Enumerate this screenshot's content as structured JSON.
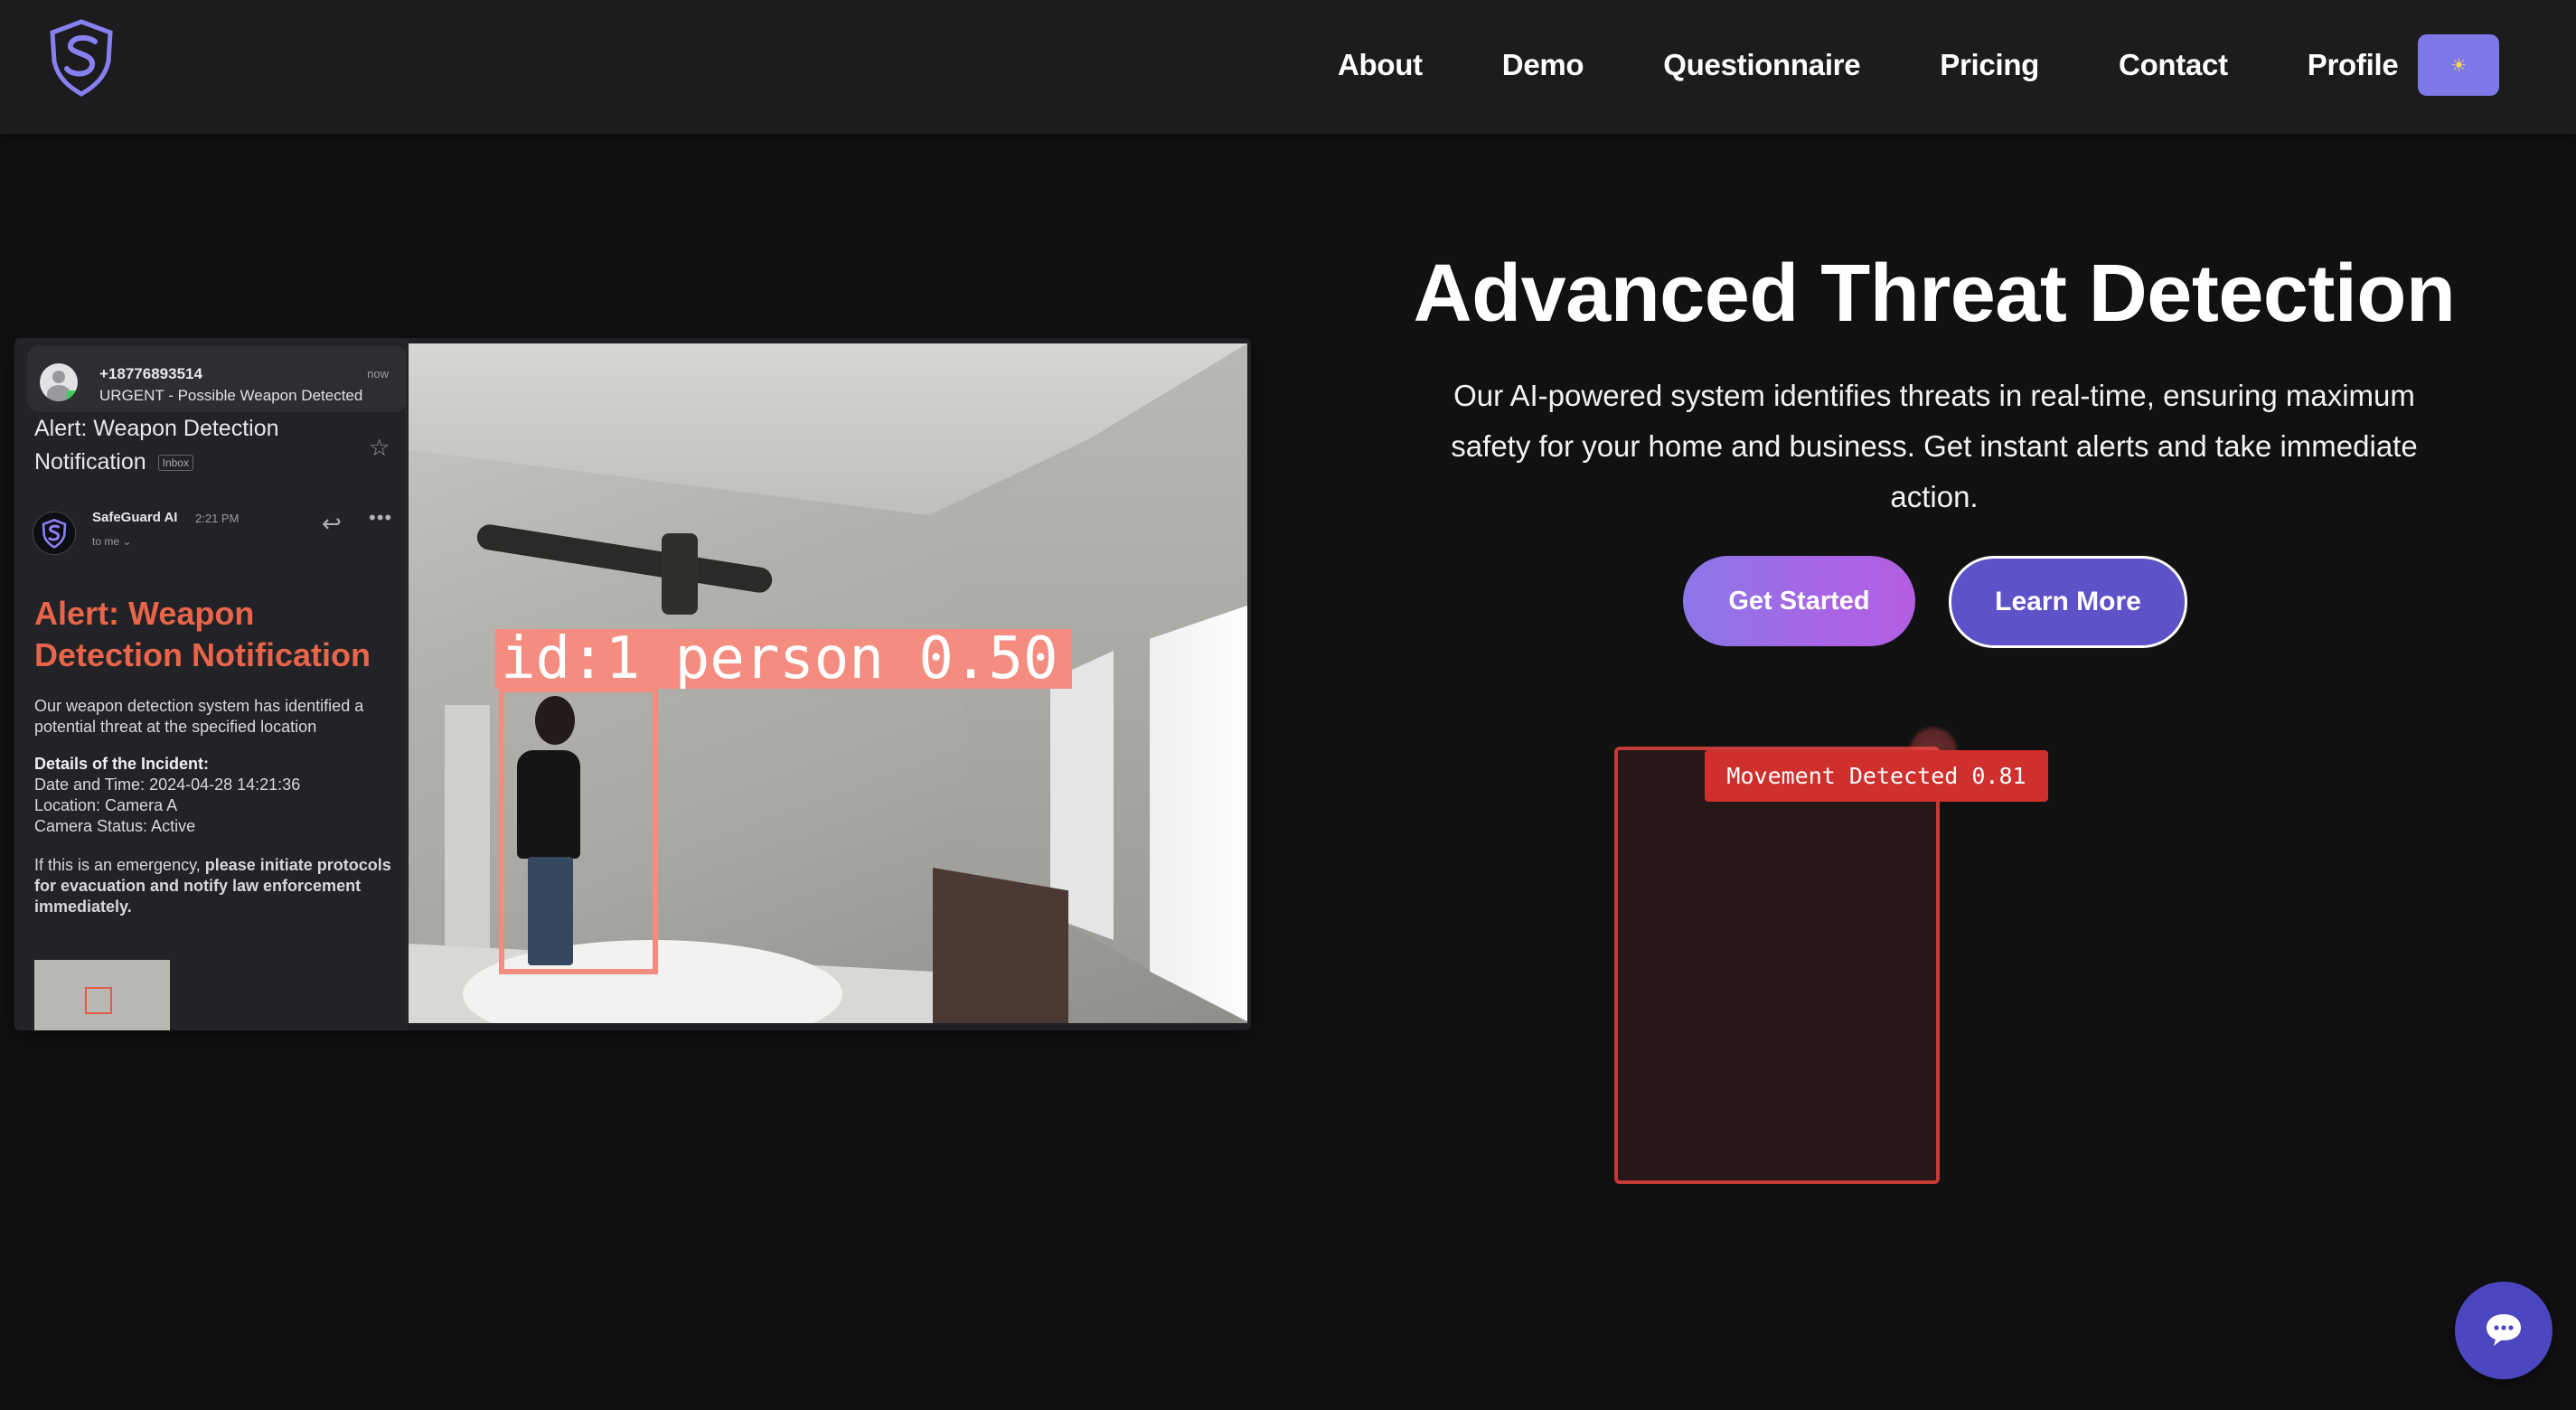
{
  "nav": {
    "logo_icon": "shield-s-icon",
    "links": [
      "About",
      "Demo",
      "Questionnaire",
      "Pricing",
      "Contact",
      "Profile"
    ],
    "theme_toggle_icon": "sun-icon",
    "theme_toggle_glyph": "☀"
  },
  "hero": {
    "title": "Advanced Threat Detection",
    "description": "Our AI-powered system identifies threats in real-time, ensuring maximum safety for your home and business. Get instant alerts and take immediate action.",
    "primary_button": "Get Started",
    "secondary_button": "Learn More"
  },
  "notification": {
    "sender_number": "+18776893514",
    "time": "now",
    "message": "URGENT - Possible Weapon Detected"
  },
  "email": {
    "subject": "Alert: Weapon Detection Notification",
    "inbox_tag": "Inbox",
    "sender_name": "SafeGuard AI",
    "sender_time": "2:21 PM",
    "to": "to me ⌄",
    "heading": "Alert: Weapon Detection Notification",
    "intro": "Our weapon detection system has identified a potential threat at the specified location",
    "details_title": "Details of the Incident:",
    "details": [
      "Date and Time: 2024-04-28 14:21:36",
      "Location: Camera A",
      "Camera Status: Active"
    ],
    "emergency_prefix": "If this is an emergency, ",
    "emergency_bold": "please initiate protocols for evacuation and notify law enforcement immediately."
  },
  "camera": {
    "detection_label": "id:1 person 0.50"
  },
  "motion": {
    "label": "Movement Detected 0.81"
  },
  "chat": {
    "icon": "chat-bubble-icon"
  },
  "colors": {
    "accent": "#7d78e8",
    "alert_red": "#d0302d",
    "email_heading": "#e8644a",
    "detection_box": "#f48c80"
  }
}
